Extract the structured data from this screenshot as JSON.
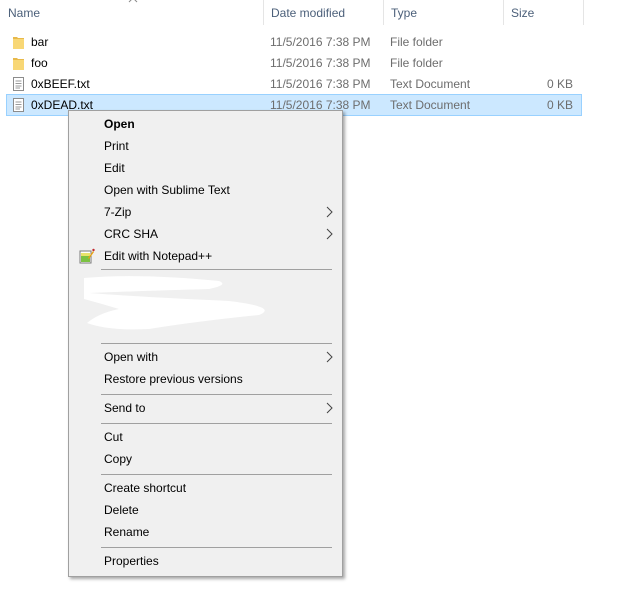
{
  "columns": {
    "name": "Name",
    "date_modified": "Date modified",
    "type": "Type",
    "size": "Size",
    "sort_indicator": "sort-ascending-icon"
  },
  "files": [
    {
      "name": "bar",
      "date": "11/5/2016 7:38 PM",
      "type": "File folder",
      "size": "",
      "icon": "folder-icon",
      "selected": false
    },
    {
      "name": "foo",
      "date": "11/5/2016 7:38 PM",
      "type": "File folder",
      "size": "",
      "icon": "folder-icon",
      "selected": false
    },
    {
      "name": "0xBEEF.txt",
      "date": "11/5/2016 7:38 PM",
      "type": "Text Document",
      "size": "0 KB",
      "icon": "text-file-icon",
      "selected": false
    },
    {
      "name": "0xDEAD.txt",
      "date": "11/5/2016 7:38 PM",
      "type": "Text Document",
      "size": "0 KB",
      "icon": "text-file-icon",
      "selected": true
    }
  ],
  "context_menu": {
    "items": [
      {
        "label": "Open",
        "bold": true
      },
      {
        "label": "Print"
      },
      {
        "label": "Edit"
      },
      {
        "label": "Open with Sublime Text"
      },
      {
        "label": "7-Zip",
        "submenu": true
      },
      {
        "label": "CRC SHA",
        "submenu": true
      },
      {
        "label": "Edit with Notepad++",
        "icon": "notepad-plus-plus-icon"
      },
      {
        "label": "Open with",
        "submenu": true
      },
      {
        "label": "Restore previous versions"
      },
      {
        "label": "Send to",
        "submenu": true
      },
      {
        "label": "Cut"
      },
      {
        "label": "Copy"
      },
      {
        "label": "Create shortcut"
      },
      {
        "label": "Delete"
      },
      {
        "label": "Rename"
      },
      {
        "label": "Properties"
      }
    ]
  },
  "colors": {
    "selection_bg": "#cce8ff",
    "selection_border": "#99d1ff",
    "menu_bg": "#f0f0f0",
    "header_text": "#4c607a",
    "folder": "#f8d775"
  }
}
